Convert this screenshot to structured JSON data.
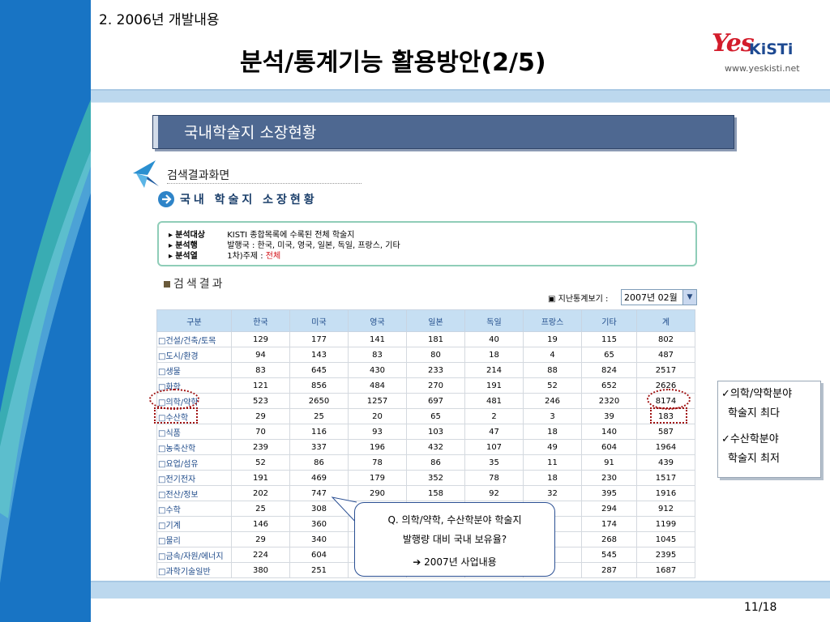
{
  "header": {
    "section": "2. 2006년 개발내용",
    "title": "분석/통계기능 활용방안(2/5)",
    "logo_yes": "Yes",
    "logo_kisti": "KiSTi",
    "logo_url": "www.yeskisti.net"
  },
  "banner": {
    "title": "국내학술지 소장현황"
  },
  "screen": {
    "caption": "검색결과화면",
    "section_title": "국내 학술지 소장현황",
    "info": {
      "target_label": "분석대상",
      "target_value": "KISTI 종합목록에 수록된 전체 학술지",
      "row_label": "분석행",
      "row_value": "발행국 : 한국, 미국, 영국, 일본, 독일, 프랑스, 기타",
      "col_label": "분석열",
      "col_prefix": "1차)주제 : ",
      "col_value": "전체"
    },
    "result_title": "검색결과",
    "prev_stats_label": "지난통계보기 :",
    "prev_stats_value": "2007년 02월"
  },
  "table": {
    "headers": [
      "구분",
      "한국",
      "미국",
      "영국",
      "일본",
      "독일",
      "프랑스",
      "기타",
      "계"
    ],
    "rows": [
      [
        "□건설/건축/토목",
        "129",
        "177",
        "141",
        "181",
        "40",
        "19",
        "115",
        "802"
      ],
      [
        "□도시/환경",
        "94",
        "143",
        "83",
        "80",
        "18",
        "4",
        "65",
        "487"
      ],
      [
        "□생물",
        "83",
        "645",
        "430",
        "233",
        "214",
        "88",
        "824",
        "2517"
      ],
      [
        "□화학",
        "121",
        "856",
        "484",
        "270",
        "191",
        "52",
        "652",
        "2626"
      ],
      [
        "□의학/약학",
        "523",
        "2650",
        "1257",
        "697",
        "481",
        "246",
        "2320",
        "8174"
      ],
      [
        "□수산학",
        "29",
        "25",
        "20",
        "65",
        "2",
        "3",
        "39",
        "183"
      ],
      [
        "□식품",
        "70",
        "116",
        "93",
        "103",
        "47",
        "18",
        "140",
        "587"
      ],
      [
        "□농축산학",
        "239",
        "337",
        "196",
        "432",
        "107",
        "49",
        "604",
        "1964"
      ],
      [
        "□요업/섬유",
        "52",
        "86",
        "78",
        "86",
        "35",
        "11",
        "91",
        "439"
      ],
      [
        "□전기전자",
        "191",
        "469",
        "179",
        "352",
        "78",
        "18",
        "230",
        "1517"
      ],
      [
        "□전산/정보",
        "202",
        "747",
        "290",
        "158",
        "92",
        "32",
        "395",
        "1916"
      ],
      [
        "□수학",
        "25",
        "308",
        "",
        "",
        "",
        "",
        "294",
        "912"
      ],
      [
        "□기계",
        "146",
        "360",
        "",
        "",
        "",
        "",
        "174",
        "1199"
      ],
      [
        "□물리",
        "29",
        "340",
        "",
        "",
        "",
        "",
        "268",
        "1045"
      ],
      [
        "□금속/자원/에너지",
        "224",
        "604",
        "",
        "",
        "",
        "",
        "545",
        "2395"
      ],
      [
        "□과학기술일반",
        "380",
        "251",
        "",
        "",
        "",
        "",
        "287",
        "1687"
      ]
    ]
  },
  "callout": {
    "line1": "✓의학/약학분야",
    "line2": "학술지 최다",
    "line3": "✓수산학분야",
    "line4": "학술지 최저"
  },
  "question": {
    "line1": "Q. 의학/약학, 수산학분야 학술지",
    "line2": "발행량 대비 국내 보유율?",
    "line3": "➔ 2007년 사업내용"
  },
  "page": {
    "number": "11/18"
  },
  "colors": {
    "left_band": "#1874c4",
    "banner": "#4e6891",
    "table_header": "#c6dff3",
    "highlight": "#a01010"
  }
}
